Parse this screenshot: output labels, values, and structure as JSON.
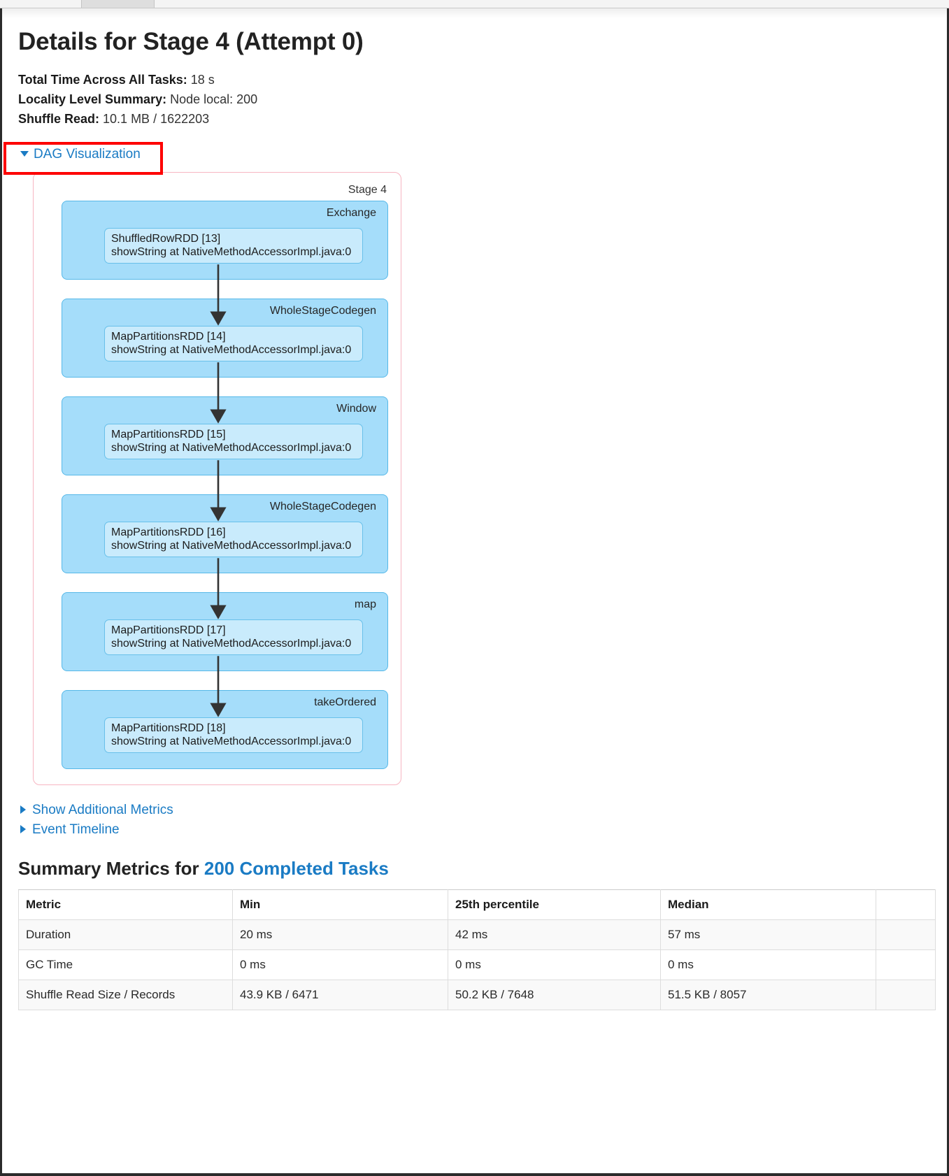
{
  "browser": {
    "tab_strip": "browser-tab-strip"
  },
  "page": {
    "title": "Details for Stage 4 (Attempt 0)"
  },
  "summary": [
    {
      "label": "Total Time Across All Tasks:",
      "value": "18 s"
    },
    {
      "label": "Locality Level Summary:",
      "value": "Node local: 200"
    },
    {
      "label": "Shuffle Read:",
      "value": "10.1 MB / 1622203"
    }
  ],
  "dag": {
    "toggle_label": "DAG Visualization",
    "stage_label": "Stage 4",
    "scopes": [
      {
        "name": "Exchange",
        "rdd_title": "ShuffledRowRDD [13]",
        "rdd_callsite": "showString at NativeMethodAccessorImpl.java:0"
      },
      {
        "name": "WholeStageCodegen",
        "rdd_title": "MapPartitionsRDD [14]",
        "rdd_callsite": "showString at NativeMethodAccessorImpl.java:0"
      },
      {
        "name": "Window",
        "rdd_title": "MapPartitionsRDD [15]",
        "rdd_callsite": "showString at NativeMethodAccessorImpl.java:0"
      },
      {
        "name": "WholeStageCodegen",
        "rdd_title": "MapPartitionsRDD [16]",
        "rdd_callsite": "showString at NativeMethodAccessorImpl.java:0"
      },
      {
        "name": "map",
        "rdd_title": "MapPartitionsRDD [17]",
        "rdd_callsite": "showString at NativeMethodAccessorImpl.java:0"
      },
      {
        "name": "takeOrdered",
        "rdd_title": "MapPartitionsRDD [18]",
        "rdd_callsite": "showString at NativeMethodAccessorImpl.java:0"
      }
    ]
  },
  "links": {
    "show_additional_metrics": "Show Additional Metrics",
    "event_timeline": "Event Timeline"
  },
  "summary_metrics": {
    "heading_prefix": "Summary Metrics for ",
    "tasks_link": "200 Completed Tasks",
    "table": {
      "columns": [
        "Metric",
        "Min",
        "25th percentile",
        "Median",
        ""
      ],
      "rows": [
        [
          "Duration",
          "20 ms",
          "42 ms",
          "57 ms",
          ""
        ],
        [
          "GC Time",
          "0 ms",
          "0 ms",
          "0 ms",
          ""
        ],
        [
          "Shuffle Read Size / Records",
          "43.9 KB / 6471",
          "50.2 KB / 7648",
          "51.5 KB / 8057",
          ""
        ]
      ]
    }
  },
  "colors": {
    "link": "#1a7bc4",
    "annotation": "#fe0000",
    "dag_border": "#f7b6c2",
    "scope_fill": "#a5ddfa",
    "rdd_fill": "#c9ebfc"
  }
}
